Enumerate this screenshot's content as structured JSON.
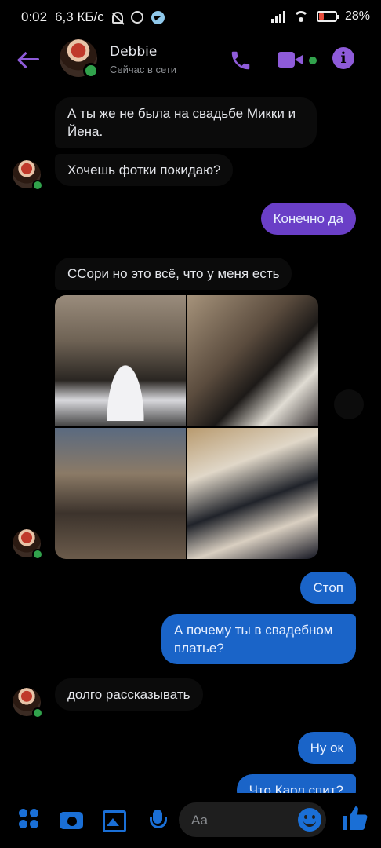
{
  "status_bar": {
    "time": "0:02",
    "speed": "6,3 КБ/с",
    "battery": "28%"
  },
  "header": {
    "name": "Debbie",
    "status": "Сейчас в сети"
  },
  "messages": [
    {
      "side": "in",
      "text": "А ты же не была на свадьбе Микки и Йена."
    },
    {
      "side": "in",
      "text": "Хочешь фотки покидаю?"
    },
    {
      "side": "out",
      "text": "Конечно да"
    },
    {
      "side": "in",
      "text": "ССори но это всё, что у меня есть"
    },
    {
      "side": "out",
      "text": "Стоп"
    },
    {
      "side": "out",
      "text": "А почему ты в свадебном платье?"
    },
    {
      "side": "in",
      "text": "долго  рассказывать"
    },
    {
      "side": "out",
      "text": "Ну ок"
    },
    {
      "side": "out",
      "text": "Что Карл спит?"
    }
  ],
  "composer": {
    "placeholder": "Аа"
  },
  "colors": {
    "accent": "#8e5bd9",
    "outgoing_blue": "#1a64c8",
    "outgoing_purple": "#6a3fc7",
    "online": "#31a24c",
    "tool_blue": "#1a6fd6"
  }
}
